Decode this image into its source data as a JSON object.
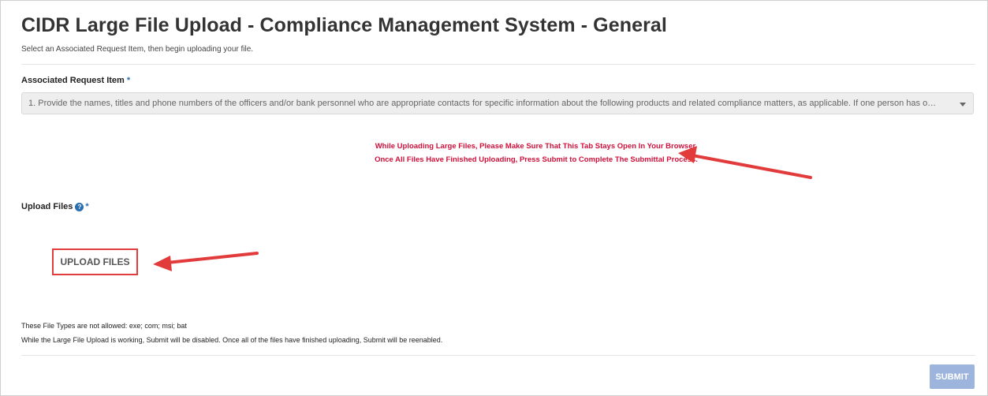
{
  "header": {
    "title": "CIDR Large File Upload - Compliance Management System - General",
    "subtitle": "Select an Associated Request Item, then begin uploading your file."
  },
  "request_item": {
    "label": "Associated Request Item",
    "required_mark": "*",
    "selected_value": "1. Provide the names, titles and phone numbers of the officers and/or bank personnel who are appropriate contacts for specific information about the following products and related compliance matters, as applicable. If one person has o…"
  },
  "notice": {
    "line1": "While Uploading Large Files, Please Make Sure That This Tab Stays Open In Your Browser.",
    "line2": "Once All Files Have Finished Uploading, Press Submit to Complete The Submittal Process.",
    "color": "#d0103a"
  },
  "upload": {
    "label": "Upload Files",
    "help_icon": "question-circle-icon",
    "required_mark": "*",
    "button_label": "UPLOAD FILES"
  },
  "footnotes": {
    "file_types": "These File Types are not allowed: exe; com; msi; bat",
    "submit_note": "While the Large File Upload is working, Submit will be disabled. Once all of the files have finished uploading, Submit will be reenabled."
  },
  "footer": {
    "submit_label": "SUBMIT",
    "submit_color": "#9db5dc"
  },
  "annotations": {
    "arrow_color": "#e23b3b"
  }
}
